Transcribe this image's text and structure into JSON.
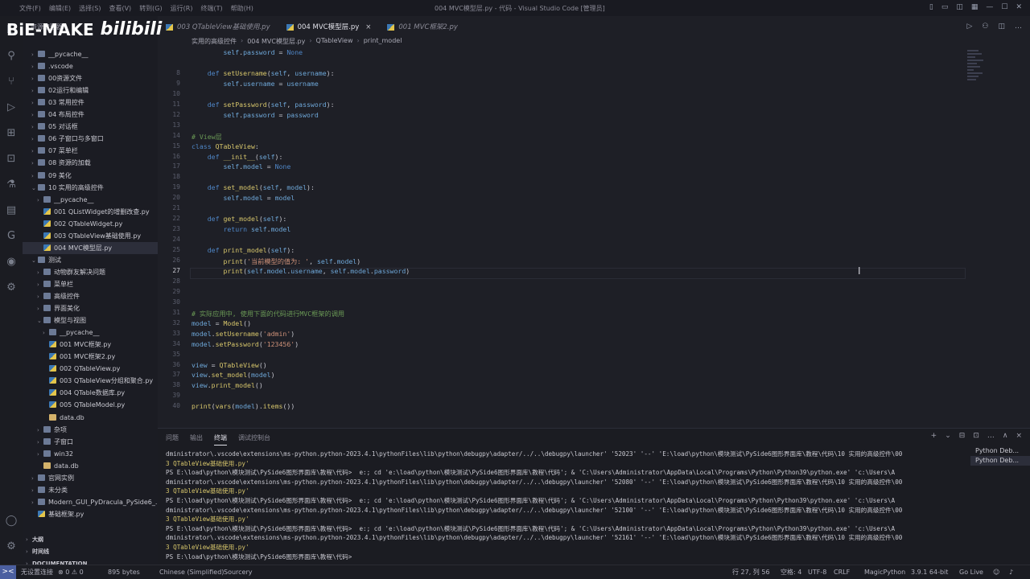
{
  "window": {
    "title": "004 MVC模型层.py - 代码 - Visual Studio Code [管理员]",
    "menu": [
      "文件(F)",
      "编辑(E)",
      "选择(S)",
      "查看(V)",
      "转到(G)",
      "运行(R)",
      "终端(T)",
      "帮助(H)"
    ]
  },
  "watermark": {
    "text": "BiE-MAKE",
    "bili": "bilibili"
  },
  "sidebar": {
    "header": "资源管理器",
    "items": [
      {
        "label": "__pycache__",
        "type": "dir",
        "depth": 1,
        "caret": "›"
      },
      {
        "label": ".vscode",
        "type": "dir",
        "depth": 1,
        "caret": "›"
      },
      {
        "label": "00资源文件",
        "type": "dir",
        "depth": 1,
        "caret": "›"
      },
      {
        "label": "02运行和编辑",
        "type": "dir",
        "depth": 1,
        "caret": "›"
      },
      {
        "label": "03 常用控件",
        "type": "dir",
        "depth": 1,
        "caret": "›"
      },
      {
        "label": "04 布局控件",
        "type": "dir",
        "depth": 1,
        "caret": "›"
      },
      {
        "label": "05 对话框",
        "type": "dir",
        "depth": 1,
        "caret": "›"
      },
      {
        "label": "06 子窗口与多窗口",
        "type": "dir",
        "depth": 1,
        "caret": "›"
      },
      {
        "label": "07 菜单栏",
        "type": "dir",
        "depth": 1,
        "caret": "›"
      },
      {
        "label": "08 资源的加载",
        "type": "dir",
        "depth": 1,
        "caret": "›"
      },
      {
        "label": "09 美化",
        "type": "dir",
        "depth": 1,
        "caret": "›"
      },
      {
        "label": "10 实用的高级控件",
        "type": "dir",
        "depth": 1,
        "caret": "⌄"
      },
      {
        "label": "__pycache__",
        "type": "dir",
        "depth": 2,
        "caret": "›"
      },
      {
        "label": "001 QListWidget的增删改查.py",
        "type": "py",
        "depth": 2,
        "caret": ""
      },
      {
        "label": "002 QTableWidget.py",
        "type": "py",
        "depth": 2,
        "caret": ""
      },
      {
        "label": "003 QTableView基础使用.py",
        "type": "py",
        "depth": 2,
        "caret": ""
      },
      {
        "label": "004 MVC模型层.py",
        "type": "py",
        "depth": 2,
        "caret": "",
        "selected": true
      },
      {
        "label": "测试",
        "type": "dir",
        "depth": 1,
        "caret": "⌄"
      },
      {
        "label": "动物群友解决问题",
        "type": "dir",
        "depth": 2,
        "caret": "›"
      },
      {
        "label": "菜单栏",
        "type": "dir",
        "depth": 2,
        "caret": "›"
      },
      {
        "label": "高级控件",
        "type": "dir",
        "depth": 2,
        "caret": "›"
      },
      {
        "label": "界面美化",
        "type": "dir",
        "depth": 2,
        "caret": "›"
      },
      {
        "label": "模型与视图",
        "type": "dir",
        "depth": 2,
        "caret": "⌄"
      },
      {
        "label": "__pycache__",
        "type": "dir",
        "depth": 3,
        "caret": "›"
      },
      {
        "label": "001 MVC框架.py",
        "type": "py",
        "depth": 3,
        "caret": ""
      },
      {
        "label": "001 MVC框架2.py",
        "type": "py",
        "depth": 3,
        "caret": ""
      },
      {
        "label": "002 QTableView.py",
        "type": "py",
        "depth": 3,
        "caret": ""
      },
      {
        "label": "003 QTableView分组和聚合.py",
        "type": "py",
        "depth": 3,
        "caret": ""
      },
      {
        "label": "004 QTable数据库.py",
        "type": "py",
        "depth": 3,
        "caret": ""
      },
      {
        "label": "005 QTableModel.py",
        "type": "py",
        "depth": 3,
        "caret": ""
      },
      {
        "label": "data.db",
        "type": "db",
        "depth": 3,
        "caret": ""
      },
      {
        "label": "杂项",
        "type": "dir",
        "depth": 2,
        "caret": "›"
      },
      {
        "label": "子窗口",
        "type": "dir",
        "depth": 2,
        "caret": "›"
      },
      {
        "label": "win32",
        "type": "dir",
        "depth": 2,
        "caret": "›"
      },
      {
        "label": "data.db",
        "type": "db",
        "depth": 2,
        "caret": ""
      },
      {
        "label": "官网实例",
        "type": "dir",
        "depth": 1,
        "caret": "›"
      },
      {
        "label": "未分类",
        "type": "dir",
        "depth": 1,
        "caret": "›"
      },
      {
        "label": "Modern_GUI_PyDracula_PySide6_...",
        "type": "dir",
        "depth": 1,
        "caret": "›"
      },
      {
        "label": "基础框架.py",
        "type": "py",
        "depth": 1,
        "caret": ""
      },
      {
        "label": "大纲",
        "type": "section",
        "depth": 0,
        "caret": "›"
      },
      {
        "label": "时间线",
        "type": "section",
        "depth": 0,
        "caret": "›"
      },
      {
        "label": "DOCUMENTATION",
        "type": "section",
        "depth": 0,
        "caret": "›"
      }
    ]
  },
  "tabs": [
    {
      "label": "003 QTableView基础使用.py",
      "active": false
    },
    {
      "label": "004 MVC模型层.py",
      "active": true,
      "close": "×"
    },
    {
      "label": "001 MVC框架2.py",
      "active": false
    }
  ],
  "breadcrumbs": [
    "实用的高级控件",
    "004 MVC模型层.py",
    "QTableView",
    "print_model"
  ],
  "editor": {
    "current_line": "27",
    "lines": [
      {
        "n": "",
        "code": "        self.password = None"
      },
      {
        "n": "",
        "code": ""
      },
      {
        "n": "8",
        "code": "    def setUsername(self, username):"
      },
      {
        "n": "9",
        "code": "        self.username = username"
      },
      {
        "n": "10",
        "code": ""
      },
      {
        "n": "11",
        "code": "    def setPassword(self, password):"
      },
      {
        "n": "12",
        "code": "        self.password = password"
      },
      {
        "n": "13",
        "code": ""
      },
      {
        "n": "14",
        "code": "# View层"
      },
      {
        "n": "15",
        "code": "class QTableView:"
      },
      {
        "n": "16",
        "code": "    def __init__(self):"
      },
      {
        "n": "17",
        "code": "        self.model = None"
      },
      {
        "n": "18",
        "code": ""
      },
      {
        "n": "19",
        "code": "    def set_model(self, model):"
      },
      {
        "n": "20",
        "code": "        self.model = model"
      },
      {
        "n": "21",
        "code": ""
      },
      {
        "n": "22",
        "code": "    def get_model(self):"
      },
      {
        "n": "23",
        "code": "        return self.model"
      },
      {
        "n": "24",
        "code": ""
      },
      {
        "n": "25",
        "code": "    def print_model(self):"
      },
      {
        "n": "26",
        "code": "        print('当前模型的值为: ', self.model)"
      },
      {
        "n": "27",
        "code": "        print(self.model.username, self.model.password)"
      },
      {
        "n": "28",
        "code": ""
      },
      {
        "n": "29",
        "code": ""
      },
      {
        "n": "30",
        "code": ""
      },
      {
        "n": "31",
        "code": "# 实际应用中, 使用下面的代码进行MVC框架的调用"
      },
      {
        "n": "32",
        "code": "model = Model()"
      },
      {
        "n": "33",
        "code": "model.setUsername('admin')"
      },
      {
        "n": "34",
        "code": "model.setPassword('123456')"
      },
      {
        "n": "35",
        "code": ""
      },
      {
        "n": "36",
        "code": "view = QTableView()"
      },
      {
        "n": "37",
        "code": "view.set_model(model)"
      },
      {
        "n": "38",
        "code": "view.print_model()"
      },
      {
        "n": "39",
        "code": ""
      },
      {
        "n": "40",
        "code": "print(vars(model).items())"
      }
    ]
  },
  "panel": {
    "tabs": [
      "问题",
      "输出",
      "终端",
      "调试控制台"
    ],
    "active_tab": "终端",
    "tools": [
      "+",
      "⌄",
      "⊟",
      "⊡",
      "…",
      "∧",
      "×"
    ],
    "terminal_lines": [
      {
        "text": "dministrator\\.vscode\\extensions\\ms-python.python-2023.4.1\\pythonFiles\\lib\\python\\debugpy\\adapter/../..\\debugpy\\launcher' '52023' '--' 'E:\\load\\python\\模块测试\\PySide6图形界面库\\教程\\代码\\10 实用的高级控件\\00",
        "y": false
      },
      {
        "text": "3 QTableView基础使用.py'",
        "y": true
      },
      {
        "text": "PS E:\\load\\python\\模块测试\\PySide6图形界面库\\教程\\代码>  e:; cd 'e:\\load\\python\\模块测试\\PySide6图形界面库\\教程\\代码'; & 'C:\\Users\\Administrator\\AppData\\Local\\Programs\\Python\\Python39\\python.exe' 'c:\\Users\\A",
        "y": false
      },
      {
        "text": "dministrator\\.vscode\\extensions\\ms-python.python-2023.4.1\\pythonFiles\\lib\\python\\debugpy\\adapter/../..\\debugpy\\launcher' '52080' '--' 'E:\\load\\python\\模块测试\\PySide6图形界面库\\教程\\代码\\10 实用的高级控件\\00",
        "y": false
      },
      {
        "text": "3 QTableView基础使用.py'",
        "y": true
      },
      {
        "text": "PS E:\\load\\python\\模块测试\\PySide6图形界面库\\教程\\代码>  e:; cd 'e:\\load\\python\\模块测试\\PySide6图形界面库\\教程\\代码'; & 'C:\\Users\\Administrator\\AppData\\Local\\Programs\\Python\\Python39\\python.exe' 'c:\\Users\\A",
        "y": false
      },
      {
        "text": "dministrator\\.vscode\\extensions\\ms-python.python-2023.4.1\\pythonFiles\\lib\\python\\debugpy\\adapter/../..\\debugpy\\launcher' '52100' '--' 'E:\\load\\python\\模块测试\\PySide6图形界面库\\教程\\代码\\10 实用的高级控件\\00",
        "y": false
      },
      {
        "text": "3 QTableView基础使用.py'",
        "y": true
      },
      {
        "text": "PS E:\\load\\python\\模块测试\\PySide6图形界面库\\教程\\代码>  e:; cd 'e:\\load\\python\\模块测试\\PySide6图形界面库\\教程\\代码'; & 'C:\\Users\\Administrator\\AppData\\Local\\Programs\\Python\\Python39\\python.exe' 'c:\\Users\\A",
        "y": false
      },
      {
        "text": "dministrator\\.vscode\\extensions\\ms-python.python-2023.4.1\\pythonFiles\\lib\\python\\debugpy\\adapter/../..\\debugpy\\launcher' '52161' '--' 'E:\\load\\python\\模块测试\\PySide6图形界面库\\教程\\代码\\10 实用的高级控件\\00",
        "y": false
      },
      {
        "text": "3 QTableView基础使用.py'",
        "y": true
      },
      {
        "text": "PS E:\\load\\python\\模块测试\\PySide6图形界面库\\教程\\代码>",
        "y": false
      }
    ],
    "sessions": [
      "Python Deb...",
      "Python Deb..."
    ]
  },
  "statusbar": {
    "remote": "><",
    "problems": "⊗ 0 ⚠ 0",
    "size": "895 bytes",
    "lang_pack": "Chinese (Simplified)",
    "sourcery": "Sourcery",
    "cursor": "行 27, 列 56",
    "spaces": "空格: 4",
    "encoding": "UTF-8",
    "eol": "CRLF",
    "language": "MagicPython",
    "interpreter": "3.9.1 64-bit",
    "golive": "Go Live",
    "left_label": "无设置连接"
  },
  "colors": {
    "accent": "#4b5fa0",
    "keyword": "#4f86c6",
    "function": "#d6c56b",
    "string": "#ce9178",
    "comment": "#6a9955"
  }
}
